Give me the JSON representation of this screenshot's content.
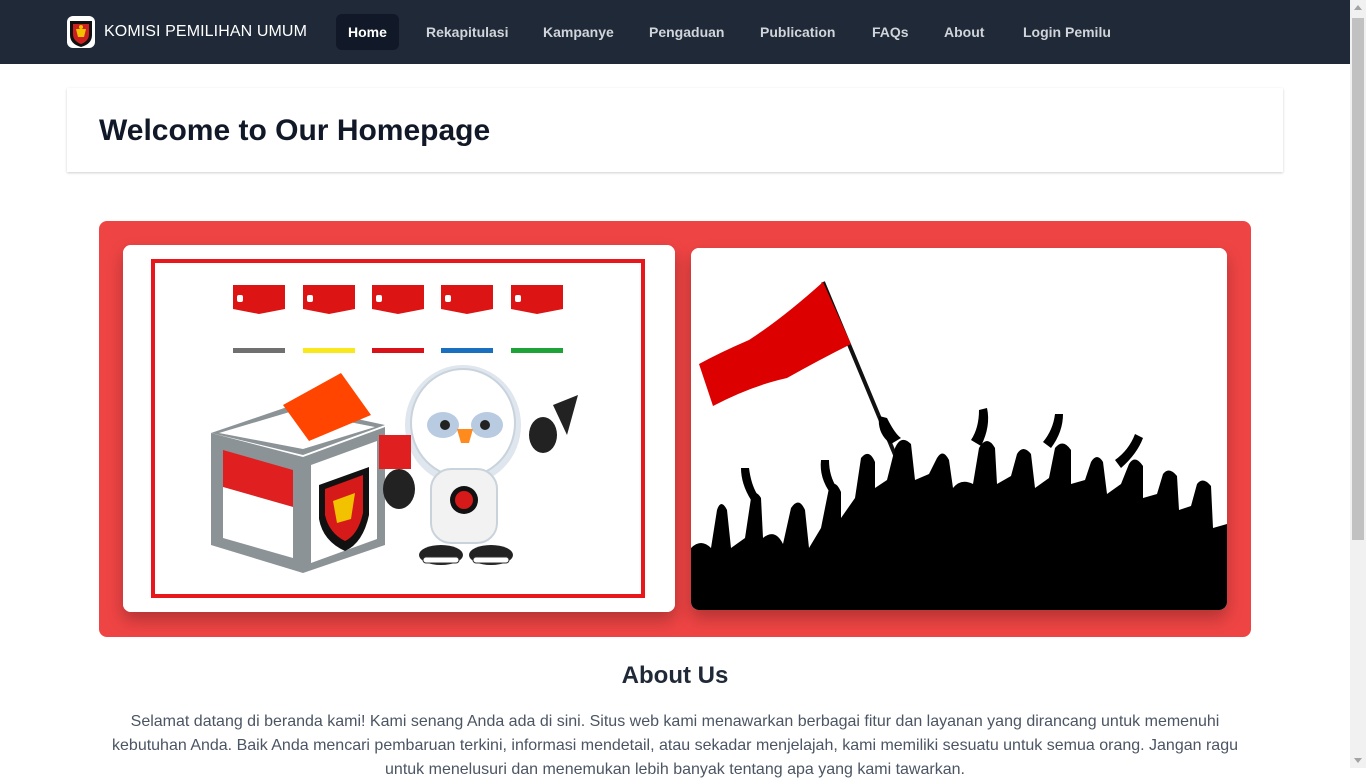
{
  "navbar": {
    "brand": "KOMISI PEMILIHAN UMUM",
    "items": [
      {
        "label": "Home",
        "active": true
      },
      {
        "label": "Rekapitulasi",
        "active": false
      },
      {
        "label": "Kampanye",
        "active": false
      },
      {
        "label": "Pengaduan",
        "active": false
      },
      {
        "label": "Publication",
        "active": false
      },
      {
        "label": "FAQs",
        "active": false
      },
      {
        "label": "About",
        "active": false
      },
      {
        "label": "Login Pemilu",
        "active": false
      }
    ]
  },
  "header": {
    "title": "Welcome to Our Homepage"
  },
  "hero": {
    "images": [
      {
        "icon": "election-ballot-mascot-illustration"
      },
      {
        "icon": "crowd-with-flag-silhouette"
      }
    ]
  },
  "about": {
    "title": "About Us",
    "text": "Selamat datang di beranda kami! Kami senang Anda ada di sini. Situs web kami menawarkan berbagai fitur dan layanan yang dirancang untuk memenuhi kebutuhan Anda. Baik Anda mencari pembaruan terkini, informasi mendetail, atau sekadar menjelajah, kami memiliki sesuatu untuk semua orang. Jangan ragu untuk menelusuri dan menemukan lebih banyak tentang apa yang kami tawarkan."
  },
  "colors": {
    "navbar": "#1f2937",
    "accent": "#ef4444",
    "flag_red": "#dc0000"
  }
}
